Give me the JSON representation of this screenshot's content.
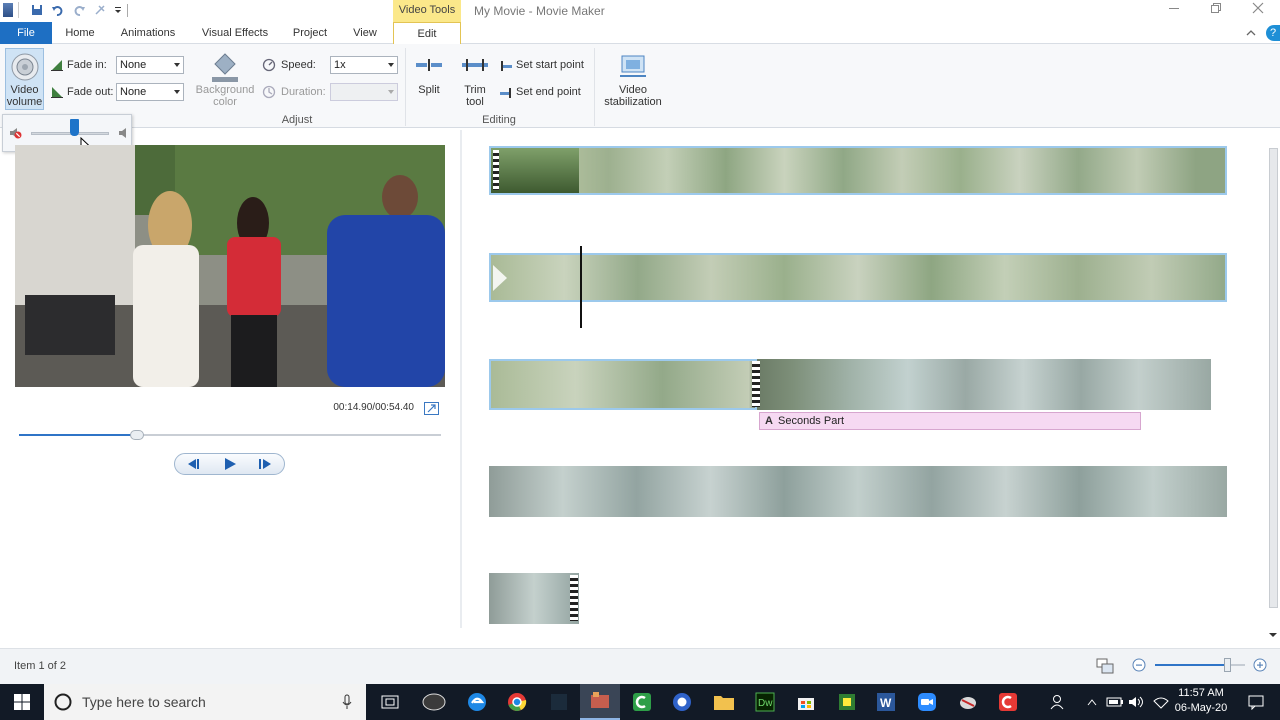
{
  "window": {
    "title": "My Movie - Movie Maker",
    "context_tab": "Video Tools"
  },
  "tabs": [
    "File",
    "Home",
    "Animations",
    "Visual Effects",
    "Project",
    "View",
    "Edit"
  ],
  "ribbon": {
    "video_volume": "Video volume",
    "fade_in_label": "Fade in:",
    "fade_in_value": "None",
    "fade_out_label": "Fade out:",
    "fade_out_value": "None",
    "background_color": "Background color",
    "speed_label": "Speed:",
    "speed_value": "1x",
    "duration_label": "Duration:",
    "duration_value": "",
    "split": "Split",
    "trim_tool": "Trim tool",
    "set_start": "Set start point",
    "set_end": "Set end point",
    "stabilization": "Video stabilization",
    "group_adjust": "Adjust",
    "group_editing": "Editing"
  },
  "player": {
    "time": "00:14.90/00:54.40",
    "progress": 0.28
  },
  "volume": {
    "level": 0.55
  },
  "storyboard": {
    "caption": "Seconds Part"
  },
  "status": {
    "item": "Item 1 of 2",
    "zoom": 0.8
  },
  "taskbar": {
    "search_placeholder": "Type here to search",
    "time": "11:57 AM",
    "date": "06-May-20"
  },
  "colors": {
    "accent": "#1e6fc3",
    "context_tab": "#fbe88a",
    "selection": "#9cc9ec",
    "caption_bg": "#f6d9f2"
  }
}
